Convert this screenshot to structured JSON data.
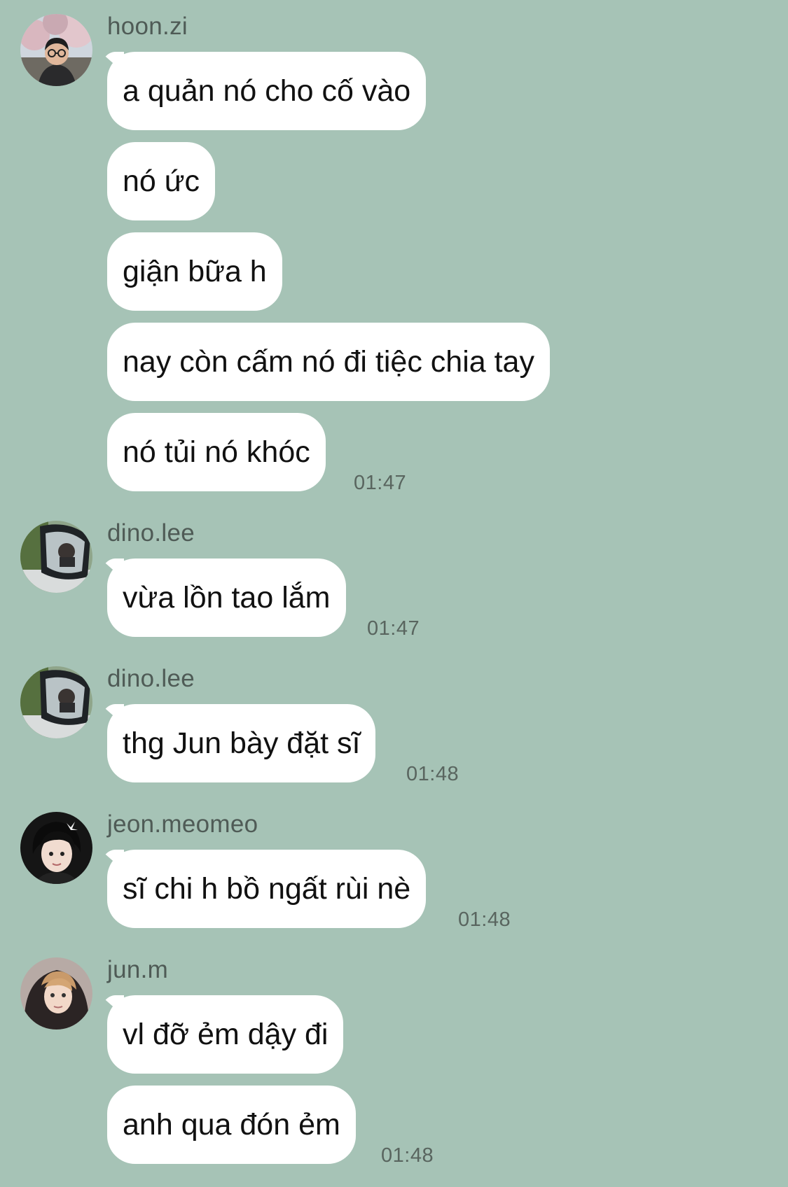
{
  "groups": [
    {
      "sender": "hoon.zi",
      "avatar": "avatar-hoon-zi",
      "messages": [
        "a quản nó cho cố vào",
        "nó ức",
        "giận bữa h",
        "nay còn cấm nó đi tiệc chia tay",
        "nó tủi nó khóc"
      ],
      "time": "01:47"
    },
    {
      "sender": "dino.lee",
      "avatar": "avatar-dino-lee",
      "messages": [
        "vừa lồn tao lắm"
      ],
      "time": "01:47"
    },
    {
      "sender": "dino.lee",
      "avatar": "avatar-dino-lee",
      "messages": [
        "thg Jun bày đặt sĩ"
      ],
      "time": "01:48"
    },
    {
      "sender": "jeon.meomeo",
      "avatar": "avatar-jeon-meomeo",
      "messages": [
        "sĩ chi h bồ ngất rùi nè"
      ],
      "time": "01:48"
    },
    {
      "sender": "jun.m",
      "avatar": "avatar-jun-m",
      "messages": [
        "vl đỡ ẻm dậy đi",
        "anh qua đón ẻm"
      ],
      "time": "01:48"
    }
  ],
  "colors": {
    "background": "#a6c3b6",
    "bubble": "#ffffff",
    "sender_text": "#4f5b56",
    "time_text": "#59655f"
  }
}
